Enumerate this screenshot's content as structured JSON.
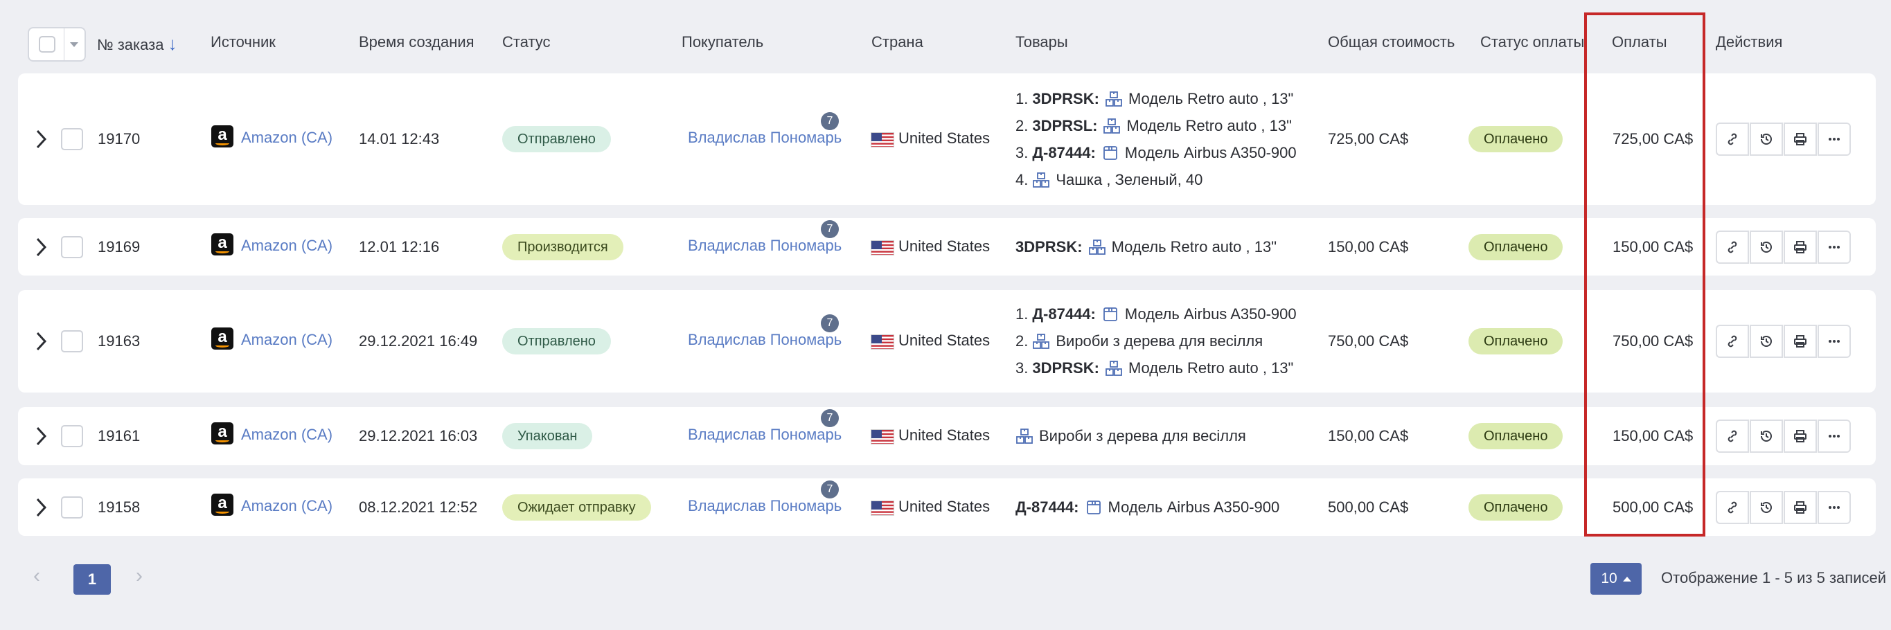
{
  "header": {
    "order_no": "№ заказа",
    "source": "Источник",
    "created": "Время создания",
    "status": "Статус",
    "buyer": "Покупатель",
    "country": "Страна",
    "goods": "Товары",
    "total": "Общая стоимость",
    "pay_status": "Статус оплаты",
    "payments": "Оплаты",
    "actions": "Действия"
  },
  "rows": [
    {
      "id": "19170",
      "source": "Amazon (CA)",
      "created": "14.01 12:43",
      "status": "Отправлено",
      "buyer": "Владислав Пономарь",
      "buyer_count": "7",
      "country": "United States",
      "goods": [
        {
          "prefix": "1.",
          "code": "3DPRSK:",
          "icon": "boxes-icon",
          "name": "Модель Retro auto , 13\""
        },
        {
          "prefix": "2.",
          "code": "3DPRSL:",
          "icon": "boxes-icon",
          "name": "Модель Retro auto , 13\""
        },
        {
          "prefix": "3.",
          "code": "Д-87444:",
          "icon": "package-icon",
          "name": "Модель Airbus A350-900"
        },
        {
          "prefix": "4.",
          "code": "",
          "icon": "boxes-icon",
          "name": "Чашка , Зеленый, 40"
        }
      ],
      "total": "725,00 CA$",
      "pay_status": "Оплачено",
      "payments": "725,00 CA$"
    },
    {
      "id": "19169",
      "source": "Amazon (CA)",
      "created": "12.01 12:16",
      "status": "Производится",
      "buyer": "Владислав Пономарь",
      "buyer_count": "7",
      "country": "United States",
      "goods": [
        {
          "prefix": "",
          "code": "3DPRSK:",
          "icon": "boxes-icon",
          "name": "Модель Retro auto , 13\""
        }
      ],
      "total": "150,00 CA$",
      "pay_status": "Оплачено",
      "payments": "150,00 CA$"
    },
    {
      "id": "19163",
      "source": "Amazon (CA)",
      "created": "29.12.2021 16:49",
      "status": "Отправлено",
      "buyer": "Владислав Пономарь",
      "buyer_count": "7",
      "country": "United States",
      "goods": [
        {
          "prefix": "1.",
          "code": "Д-87444:",
          "icon": "package-icon",
          "name": "Модель Airbus A350-900"
        },
        {
          "prefix": "2.",
          "code": "",
          "icon": "boxes-icon",
          "name": "Вироби з дерева для весілля"
        },
        {
          "prefix": "3.",
          "code": "3DPRSK:",
          "icon": "boxes-icon",
          "name": "Модель Retro auto , 13\""
        }
      ],
      "total": "750,00 CA$",
      "pay_status": "Оплачено",
      "payments": "750,00 CA$"
    },
    {
      "id": "19161",
      "source": "Amazon (CA)",
      "created": "29.12.2021 16:03",
      "status": "Упакован",
      "buyer": "Владислав Пономарь",
      "buyer_count": "7",
      "country": "United States",
      "goods": [
        {
          "prefix": "",
          "code": "",
          "icon": "boxes-icon",
          "name": "Вироби з дерева для весілля"
        }
      ],
      "total": "150,00 CA$",
      "pay_status": "Оплачено",
      "payments": "150,00 CA$"
    },
    {
      "id": "19158",
      "source": "Amazon (CA)",
      "created": "08.12.2021 12:52",
      "status": "Ожидает отправку",
      "buyer": "Владислав Пономарь",
      "buyer_count": "7",
      "country": "United States",
      "goods": [
        {
          "prefix": "",
          "code": "Д-87444:",
          "icon": "package-icon",
          "name": "Модель Airbus A350-900"
        }
      ],
      "total": "500,00 CA$",
      "pay_status": "Оплачено",
      "payments": "500,00 CA$"
    }
  ],
  "pagination": {
    "prev": "‹",
    "current": "1",
    "next": "›",
    "per_page": "10",
    "summary": "Отображение 1 - 5 из 5 записей"
  },
  "colors": {
    "link": "#5a7cc4",
    "accent": "#4e66a8",
    "highlight": "#c62828",
    "status_sent": "#daf0e6",
    "status_production": "#e3efb8",
    "paid": "#dcebb0"
  }
}
